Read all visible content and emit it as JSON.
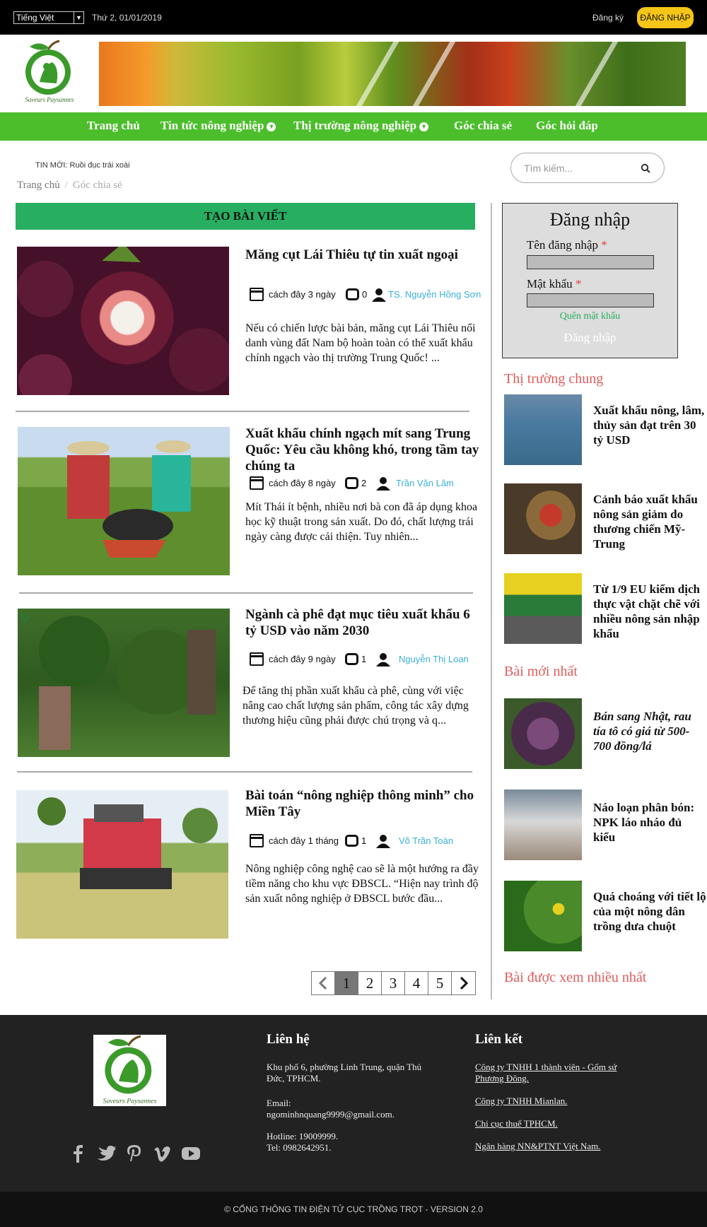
{
  "topbar": {
    "language": "Tiếng Việt",
    "date": "Thứ 2, 01/01/2019",
    "register": "Đăng ký",
    "login": "ĐĂNG NHẬP"
  },
  "logo": {
    "text": "Saveurs Paysannes"
  },
  "nav": {
    "items": [
      {
        "label": "Trang chủ",
        "dropdown": false
      },
      {
        "label": "Tin tức nông nghiệp",
        "dropdown": true
      },
      {
        "label": "Thị trường nông nghiệp",
        "dropdown": true
      },
      {
        "label": "Góc chia sẻ",
        "dropdown": false
      },
      {
        "label": "Góc hỏi đáp",
        "dropdown": false
      }
    ]
  },
  "ticker": "TIN MỚI: Ruồi đục trái xoài",
  "search": {
    "placeholder": "Tìm kiếm..."
  },
  "breadcrumb": {
    "home": "Trang chủ",
    "separator": "/",
    "current": "Góc chia sẻ"
  },
  "create_post": "TẠO BÀI VIẾT",
  "articles": [
    {
      "title": "Măng cụt Lái Thiêu tự tin xuất ngoại",
      "time": "cách đây 3 ngày",
      "comments": "0",
      "author": "TS. Nguyễn Hồng Sơn",
      "excerpt": "Nếu có chiến lược bài bản, măng cụt Lái Thiêu nổi danh vùng đất Nam bộ hoàn toàn có thể xuất khẩu chính ngạch vào thị trường Trung Quốc! ..."
    },
    {
      "title": "Xuất khẩu chính ngạch mít sang Trung Quốc: Yêu cầu không khó, trong tầm tay chúng ta",
      "time": "cách đây 8 ngày",
      "comments": "2",
      "author": "Trần Văn Lâm",
      "excerpt": "Mít Thái ít bệnh, nhiều nơi bà con đã áp dụng khoa học kỹ thuật trong sản xuất. Do đó, chất lượng trái ngày càng được cải thiện. Tuy nhiên..."
    },
    {
      "title": "Ngành cà phê đạt mục tiêu xuất khẩu 6 tỷ USD vào năm 2030",
      "time": "cách đây 9 ngày",
      "comments": "1",
      "author": "Nguyễn Thị Loan",
      "excerpt": "Để tăng thị phần xuất khẩu cà phê, cùng với việc nâng cao chất lượng sản phẩm, công tác xây dựng thương hiệu cũng phải được chú trọng và q..."
    },
    {
      "title": "Bài toán “nông nghiệp thông minh” cho Miền Tây",
      "time": "cách đây 1 tháng",
      "comments": "1",
      "author": "Võ Trần Toàn",
      "excerpt": "Nông nghiệp công nghệ cao sẽ là một hướng ra đầy tiềm năng cho khu vực ĐBSCL. “Hiện nay trình độ sản xuất nông nghiệp ở ĐBSCL bước đầu..."
    }
  ],
  "pagination": {
    "pages": [
      "1",
      "2",
      "3",
      "4",
      "5"
    ],
    "current": "1"
  },
  "login_box": {
    "title": "Đăng nhập",
    "username_label": "Tên đăng nhập",
    "password_label": "Mật khẩu",
    "required_mark": "*",
    "forgot": "Quên mật khẩu",
    "submit": "Đăng nhập"
  },
  "sidebar": {
    "market_heading": "Thị trường chung",
    "market_items": [
      {
        "title": "Xuất khẩu nông, lâm, thủy sản đạt trên 30 tỷ USD"
      },
      {
        "title": "Cảnh báo xuất khẩu nông sản giảm do thương chiến Mỹ-Trung"
      },
      {
        "title": "Từ 1/9 EU kiểm dịch thực vật chặt chẽ với nhiều nông sản nhập khẩu"
      }
    ],
    "new_heading": "Bài mới nhất",
    "new_items": [
      {
        "title": "Bán sang Nhật, rau tía tô có giá từ 500-700 đồng/lá"
      },
      {
        "title": "Náo loạn phân bón: NPK láo nháo đủ kiểu"
      },
      {
        "title": "Quá choáng với tiết lộ của một nông dân trồng dưa chuột"
      }
    ],
    "popular_heading": "Bài được xem nhiều nhất"
  },
  "footer": {
    "contact_heading": "Liên hệ",
    "address": "Khu phố 6, phường Linh Trung, quận Thủ Đức, TPHCM.",
    "email_label": "Email:",
    "email": "ngominhnquang9999@gmail.com.",
    "hotline": "Hotline: 19009999.",
    "tel": "Tel: 0982642951.",
    "links_heading": "Liên kết",
    "links": [
      "Công ty TNHH 1 thành viên - Gốm sứ Phương Đông.",
      "Công ty TNHH Mianlan.",
      "Chi cục thuế TPHCM.",
      "Ngân hàng NN&PTNT Việt Nam."
    ],
    "socials": [
      "facebook-icon",
      "twitter-icon",
      "pinterest-icon",
      "vimeo-icon",
      "youtube-icon"
    ]
  },
  "copyright": "© CỔNG THÔNG TIN ĐIỆN TỬ CỤC TRỒNG TRỌT - VERSION 2.0",
  "colors": {
    "nav_green": "#4cbe2c",
    "create_green": "#27ae60",
    "login_yellow": "#f5c518",
    "heading_red": "#e05c5c",
    "author_blue": "#3ab0d8"
  }
}
